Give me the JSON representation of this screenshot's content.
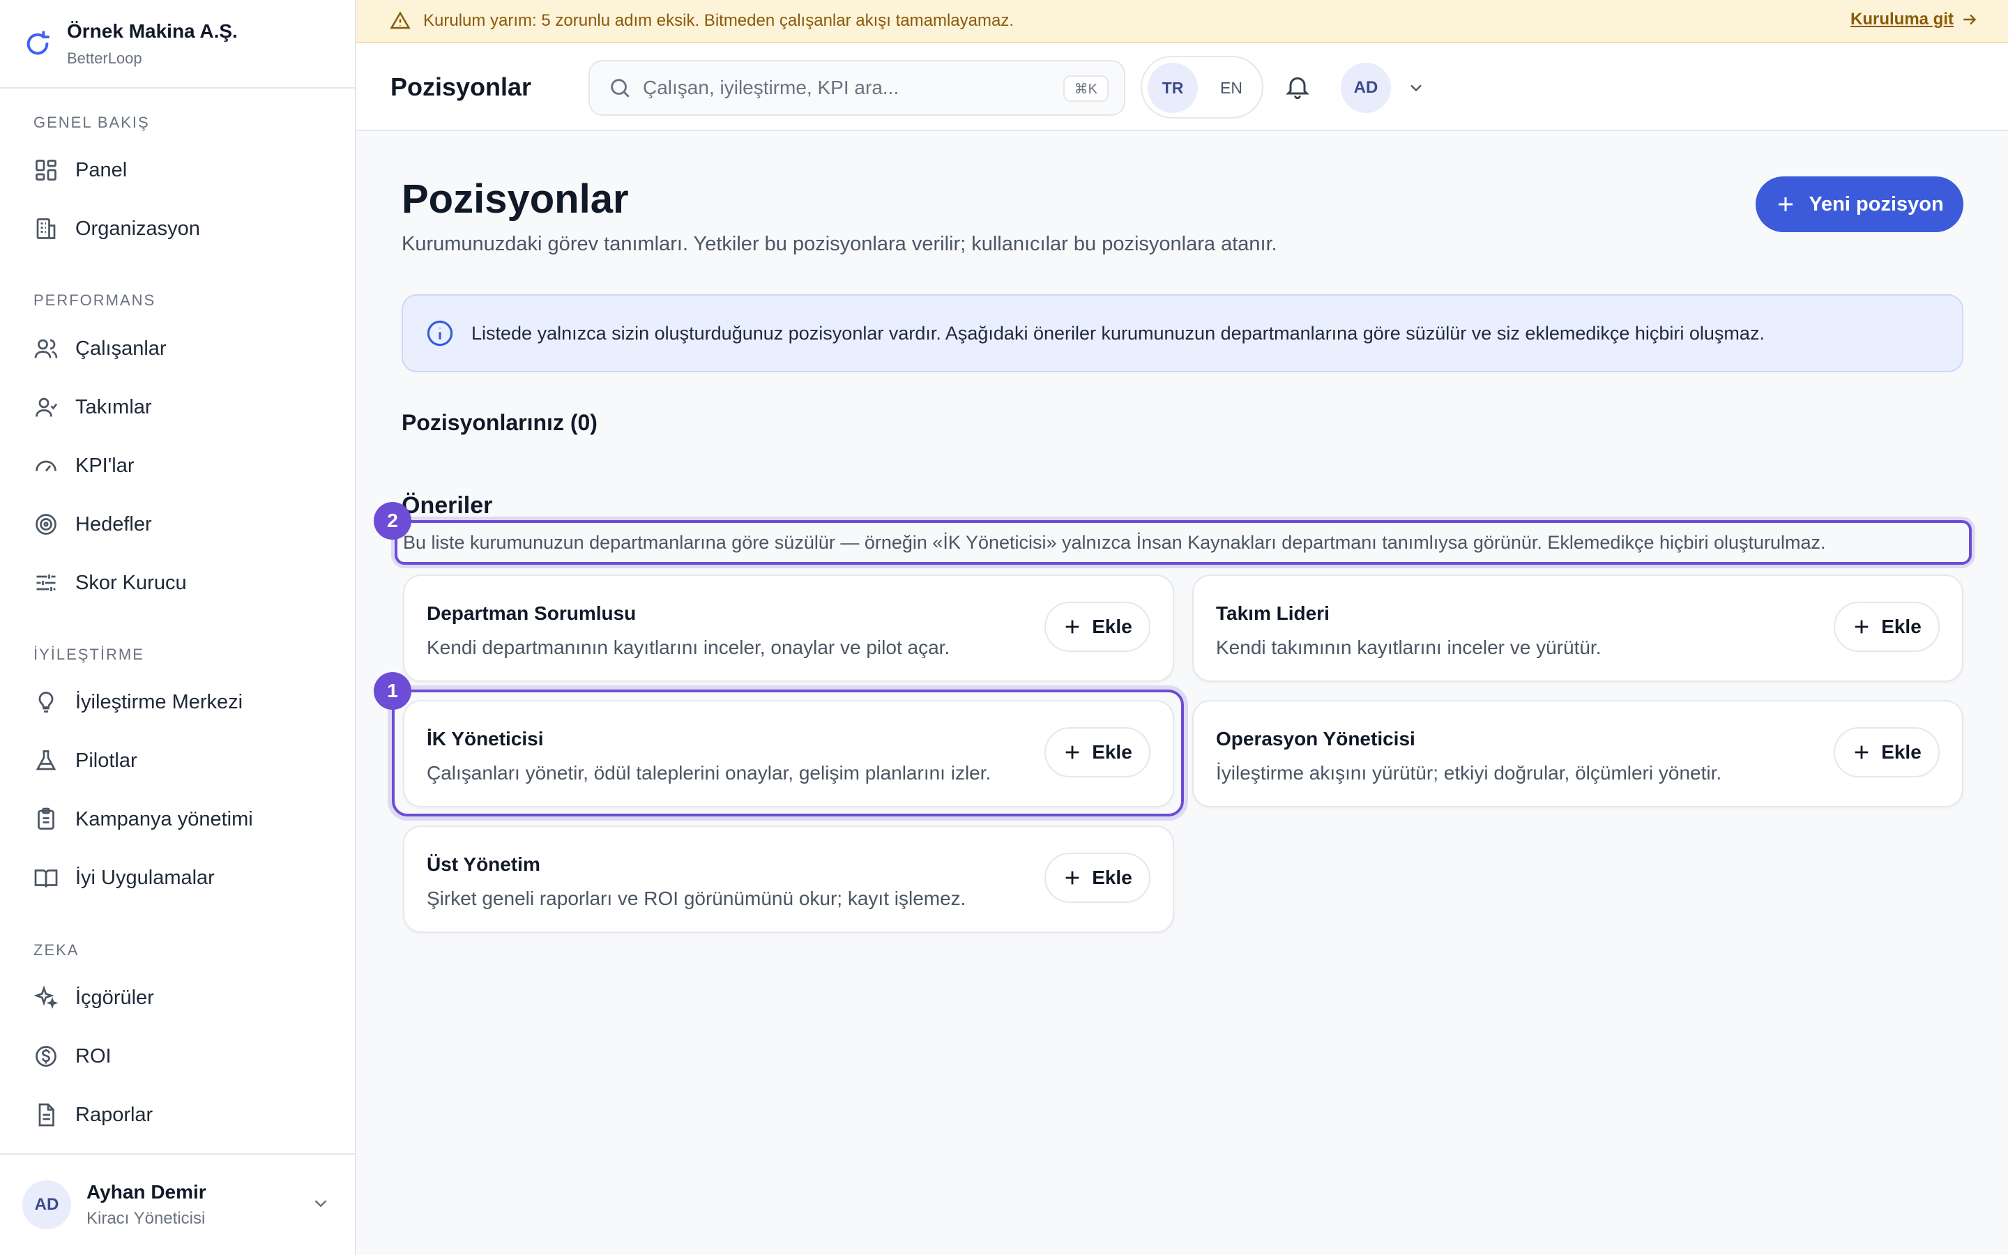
{
  "banner": {
    "message": "Kurulum yarım: 5 zorunlu adım eksik. Bitmeden çalışanlar akışı tamamlayamaz.",
    "link": "Kuruluma git"
  },
  "brand": {
    "org": "Örnek Makina A.Ş.",
    "app": "BetterLoop"
  },
  "sidebar": {
    "sections": [
      {
        "heading": "GENEL BAKIŞ",
        "items": [
          {
            "label": "Panel",
            "icon": "grid-icon"
          },
          {
            "label": "Organizasyon",
            "icon": "building-icon"
          }
        ]
      },
      {
        "heading": "PERFORMANS",
        "items": [
          {
            "label": "Çalışanlar",
            "icon": "users-icon"
          },
          {
            "label": "Takımlar",
            "icon": "team-icon"
          },
          {
            "label": "KPI'lar",
            "icon": "gauge-icon"
          },
          {
            "label": "Hedefler",
            "icon": "target-icon"
          },
          {
            "label": "Skor Kurucu",
            "icon": "sliders-icon"
          }
        ]
      },
      {
        "heading": "İYİLEŞTİRME",
        "items": [
          {
            "label": "İyileştirme Merkezi",
            "icon": "lightbulb-icon"
          },
          {
            "label": "Pilotlar",
            "icon": "flask-icon"
          },
          {
            "label": "Kampanya yönetimi",
            "icon": "clipboard-icon"
          },
          {
            "label": "İyi Uygulamalar",
            "icon": "book-icon"
          }
        ]
      },
      {
        "heading": "ZEKA",
        "items": [
          {
            "label": "İçgörüler",
            "icon": "sparkles-icon"
          },
          {
            "label": "ROI",
            "icon": "dollar-icon"
          },
          {
            "label": "Raporlar",
            "icon": "file-icon"
          }
        ]
      }
    ],
    "user": {
      "initials": "AD",
      "name": "Ayhan Demir",
      "role": "Kiracı Yöneticisi"
    }
  },
  "header": {
    "title": "Pozisyonlar",
    "search_placeholder": "Çalışan, iyileştirme, KPI ara...",
    "shortcut": "⌘K",
    "lang_tr": "TR",
    "lang_en": "EN",
    "avatar": "AD"
  },
  "main": {
    "title": "Pozisyonlar",
    "subtitle": "Kurumunuzdaki görev tanımları. Yetkiler bu pozisyonlara verilir; kullanıcılar bu pozisyonlara atanır.",
    "new_button": "Yeni pozisyon",
    "info": "Listede yalnızca sizin oluşturduğunuz pozisyonlar vardır. Aşağıdaki öneriler kurumunuzun departmanlarına göre süzülür ve siz eklemedikçe hiçbiri oluşmaz.",
    "your_positions": "Pozisyonlarınız (0)",
    "suggestions_title": "Öneriler",
    "suggestions_hint": "Bu liste kurumunuzun departmanlarına göre süzülür — örneğin «İK Yöneticisi» yalnızca İnsan Kaynakları departmanı tanımlıysa görünür. Eklemedikçe hiçbiri oluşturulmaz.",
    "add_label": "Ekle",
    "badges": [
      "1",
      "2"
    ],
    "suggestions": [
      {
        "title": "Departman Sorumlusu",
        "desc": "Kendi departmanının kayıtlarını inceler, onaylar ve pilot açar."
      },
      {
        "title": "Takım Lideri",
        "desc": "Kendi takımının kayıtlarını inceler ve yürütür."
      },
      {
        "title": "İK Yöneticisi",
        "desc": "Çalışanları yönetir, ödül taleplerini onaylar, gelişim planlarını izler."
      },
      {
        "title": "Operasyon Yöneticisi",
        "desc": "İyileştirme akışını yürütür; etkiyi doğrular, ölçümleri yönetir."
      },
      {
        "title": "Üst Yönetim",
        "desc": "Şirket geneli raporları ve ROI görünümünü okur; kayıt işlemez."
      }
    ]
  }
}
